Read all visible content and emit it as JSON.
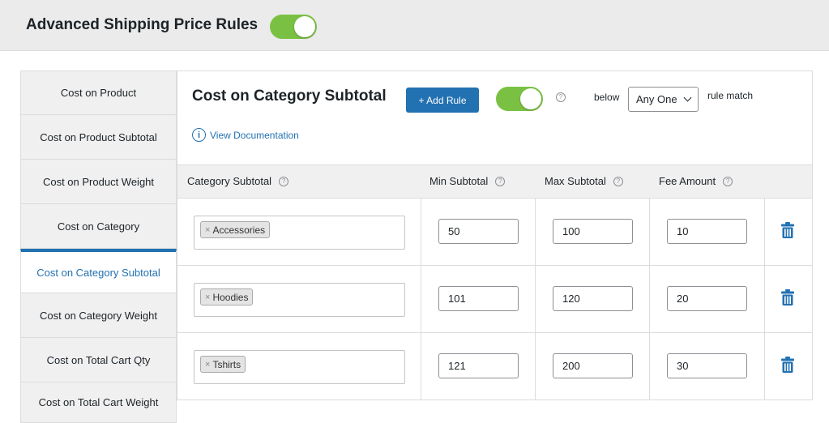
{
  "header": {
    "title": "Advanced Shipping Price Rules"
  },
  "sidebar": {
    "items": [
      {
        "label": "Cost on Product"
      },
      {
        "label": "Cost on Product Subtotal"
      },
      {
        "label": "Cost on Product Weight"
      },
      {
        "label": "Cost on Category"
      },
      {
        "label": "Cost on Category Subtotal",
        "active": true
      },
      {
        "label": "Cost on Category Weight"
      },
      {
        "label": "Cost on Total Cart Qty"
      },
      {
        "label": "Cost on Total Cart Weight"
      }
    ]
  },
  "panel": {
    "title": "Cost on Category Subtotal",
    "add_rule_label": "+ Add Rule",
    "below_label": "below",
    "select_value": "Any One",
    "rule_match_label": "rule match",
    "doc_link_label": "View Documentation",
    "help_glyph": "?",
    "info_glyph": "i"
  },
  "table": {
    "headers": [
      "Category Subtotal",
      "Min Subtotal",
      "Max Subtotal",
      "Fee Amount"
    ],
    "rows": [
      {
        "category": "Accessories",
        "min": "50",
        "max": "100",
        "fee": "10"
      },
      {
        "category": "Hoodies",
        "min": "101",
        "max": "120",
        "fee": "20"
      },
      {
        "category": "Tshirts",
        "min": "121",
        "max": "200",
        "fee": "30"
      }
    ],
    "tag_remove_glyph": "×"
  },
  "colors": {
    "accent": "#2271b1",
    "toggle_on": "#7ac143"
  },
  "icons": {
    "toggle": "toggle-switch-on",
    "help": "question-circle-icon",
    "info": "info-circle-icon",
    "delete": "trash-icon",
    "dropdown": "chevron-down-icon"
  }
}
